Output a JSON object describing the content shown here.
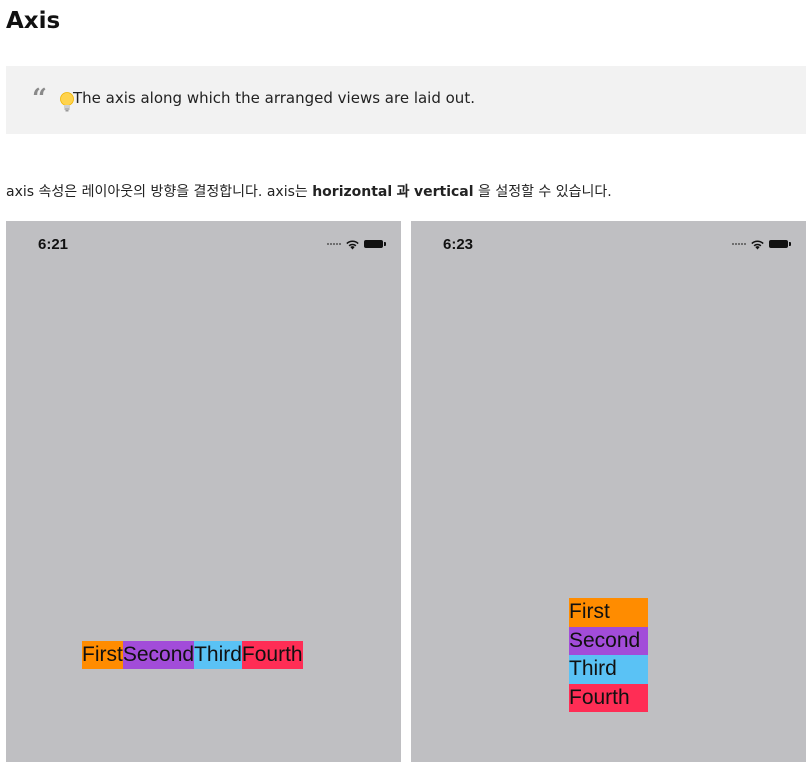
{
  "heading": "Axis",
  "quote": {
    "mark": "“",
    "icon": "lightbulb-icon",
    "text": "The axis along which the arranged views are laid out."
  },
  "description": {
    "part1": "axis 속성은 레이아웃의 방향을 결정합니다. axis는 ",
    "bold1": "horizontal",
    "part2": " ",
    "bold2": "과",
    "part3": " ",
    "bold3": "vertical",
    "part4": " 을 설정할 수 있습니다."
  },
  "screens": [
    {
      "time": "6:21",
      "axis": "horizontal",
      "labels": [
        "First",
        "Second",
        "Third",
        "Fourth"
      ]
    },
    {
      "time": "6:23",
      "axis": "vertical",
      "labels": [
        "First",
        "Second",
        "Third",
        "Fourth"
      ]
    }
  ],
  "colors": {
    "first": "#ff8c00",
    "second": "#a24cd9",
    "third": "#5ac2f5",
    "fourth": "#ff2d55",
    "screen_bg": "#bfbfc2",
    "quote_bg": "#f2f2f2"
  }
}
